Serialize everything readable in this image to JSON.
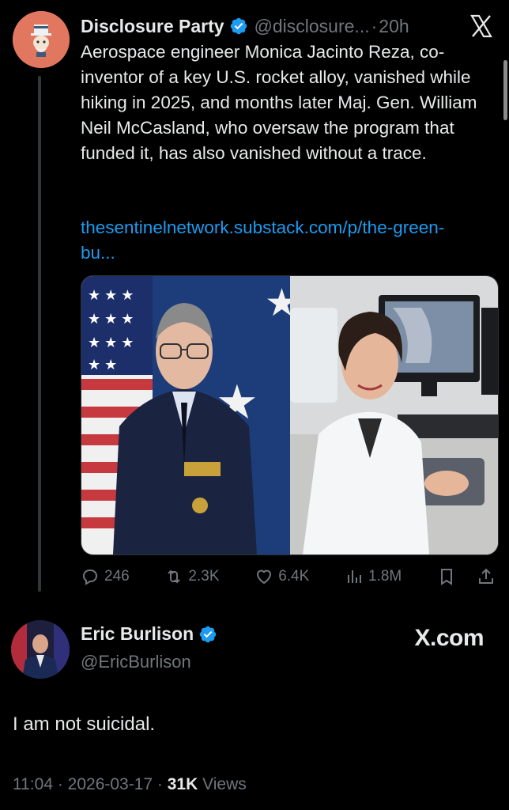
{
  "tweet": {
    "author_name": "Disclosure Party",
    "handle": "@disclosure...",
    "separator": "·",
    "time": "20h",
    "text": "Aerospace engineer Monica Jacinto Reza, co-inventor of a key U.S. rocket alloy, vanished while hiking in 2025, and months later Maj. Gen. William Neil McCasland, who oversaw the program that funded it, has also vanished without a trace.",
    "link": "thesentinelnetwork.substack.com/p/the-green-bu...",
    "actions": {
      "replies": "246",
      "reposts": "2.3K",
      "likes": "6.4K",
      "views": "1.8M"
    }
  },
  "reply": {
    "author_name": "Eric Burlison",
    "handle": "@EricBurlison",
    "watermark": "X.com",
    "text": "I am not suicidal.",
    "date": "11:04 · 2026-03-17 ·",
    "views_count": "31K",
    "views_label": "Views"
  },
  "icons": {
    "verified": "verified-badge-icon",
    "close": "x-logo-icon",
    "reply": "reply-icon",
    "repost": "repost-icon",
    "like": "heart-icon",
    "views": "views-icon",
    "bookmark": "bookmark-icon",
    "share": "share-icon"
  },
  "colors": {
    "background": "#000000",
    "text": "#e7e9ea",
    "muted": "#71767b",
    "link": "#1d9bf0",
    "verified": "#1d9bf0"
  }
}
